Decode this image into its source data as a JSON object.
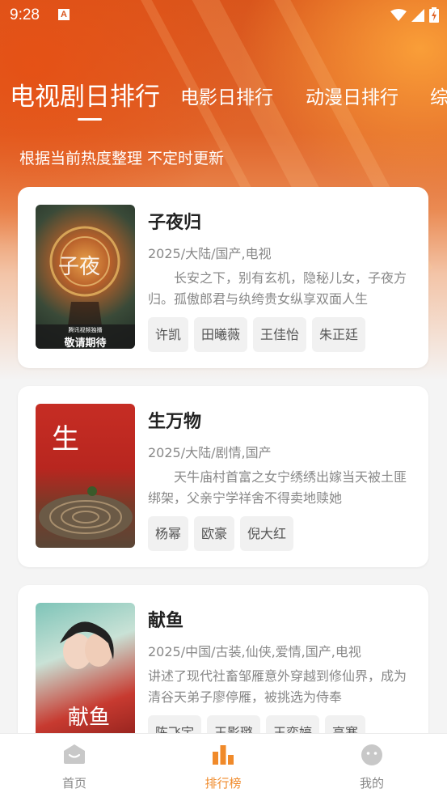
{
  "status": {
    "time": "9:28",
    "notification_icon": "A"
  },
  "tabs": [
    {
      "label": "电视剧日排行",
      "active": true
    },
    {
      "label": "电影日排行",
      "active": false
    },
    {
      "label": "动漫日排行",
      "active": false
    },
    {
      "label": "综",
      "active": false
    }
  ],
  "subtitle": "根据当前热度整理 不定时更新",
  "items": [
    {
      "title": "子夜归",
      "meta": "2025/大陆/国产,电视",
      "desc": "长安之下，别有玄机，隐秘儿女，子夜方归。孤傲郎君与纨绔贵女纵享双面人生",
      "tags": [
        "许凯",
        "田曦薇",
        "王佳怡",
        "朱正廷"
      ],
      "poster_text": "敬请期待",
      "poster_sub": "腾讯视频独播"
    },
    {
      "title": "生万物",
      "meta": "2025/大陆/剧情,国产",
      "desc": "天牛庙村首富之女宁绣绣出嫁当天被土匪绑架，父亲宁学祥舍不得卖地赎她",
      "tags": [
        "杨幂",
        "欧豪",
        "倪大红"
      ]
    },
    {
      "title": "献鱼",
      "meta": "2025/中国/古装,仙侠,爱情,国产,电视",
      "desc": "讲述了现代社畜邹雁意外穿越到修仙界，成为清谷天弟子廖停雁，被挑选为侍奉",
      "tags": [
        "陈飞宇",
        "王影璐",
        "王奕婷",
        "高寒"
      ]
    }
  ],
  "nav": [
    {
      "label": "首页",
      "icon": "home-icon",
      "active": false
    },
    {
      "label": "排行榜",
      "icon": "bar-chart-icon",
      "active": true
    },
    {
      "label": "我的",
      "icon": "profile-icon",
      "active": false
    }
  ],
  "colors": {
    "accent": "#f08a2a",
    "hero": "#d9551c"
  }
}
